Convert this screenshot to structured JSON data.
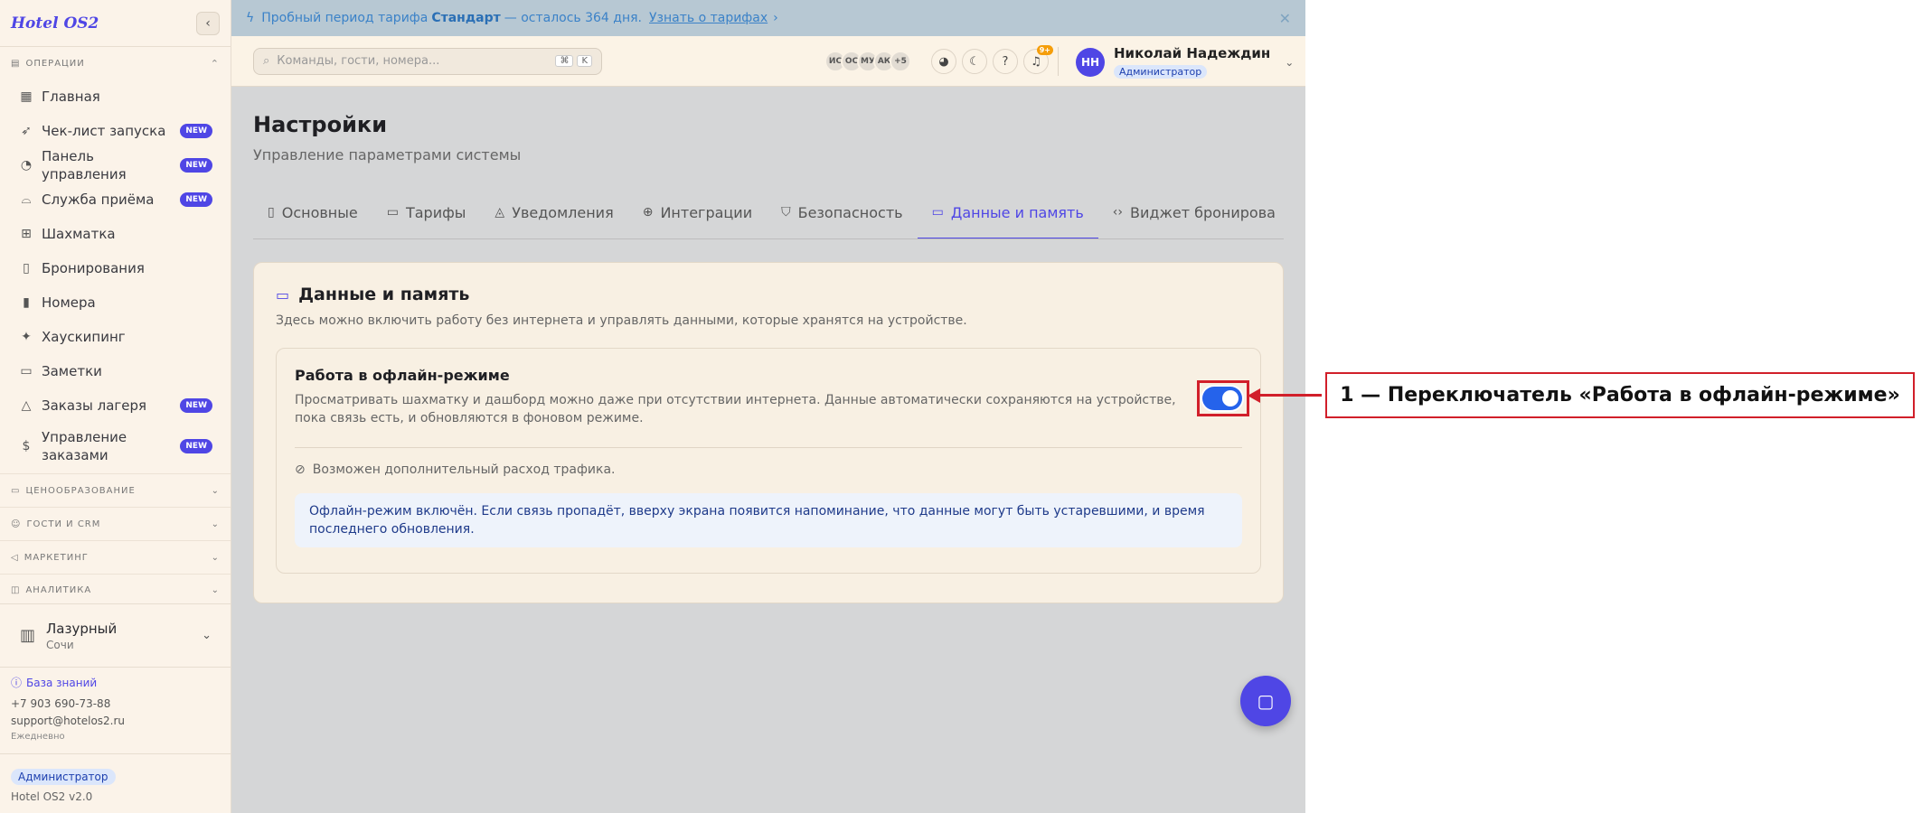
{
  "sidebar": {
    "logo": "Hotel OS2",
    "sections": {
      "operations": "ОПЕРАЦИИ"
    },
    "items": [
      {
        "label": "Главная",
        "icon": "dashboard-icon",
        "badge": ""
      },
      {
        "label": "Чек-лист запуска",
        "icon": "rocket-icon",
        "badge": "NEW"
      },
      {
        "label": "Панель управления",
        "icon": "gauge-icon",
        "badge": "NEW"
      },
      {
        "label": "Служба приёма",
        "icon": "bell-desk-icon",
        "badge": "NEW"
      },
      {
        "label": "Шахматка",
        "icon": "grid-icon",
        "badge": ""
      },
      {
        "label": "Бронирования",
        "icon": "clipboard-icon",
        "badge": ""
      },
      {
        "label": "Номера",
        "icon": "door-icon",
        "badge": ""
      },
      {
        "label": "Хаускипинг",
        "icon": "sparkle-icon",
        "badge": ""
      },
      {
        "label": "Заметки",
        "icon": "note-icon",
        "badge": ""
      },
      {
        "label": "Заказы лагеря",
        "icon": "tent-icon",
        "badge": "NEW"
      },
      {
        "label": "Управление заказами",
        "icon": "receipt-icon",
        "badge": "NEW"
      }
    ],
    "collapsed_sections": [
      "ЦЕНООБРАЗОВАНИЕ",
      "ГОСТИ И CRM",
      "МАРКЕТИНГ",
      "АНАЛИТИКА"
    ],
    "hotel": {
      "name": "Лазурный",
      "city": "Сочи"
    },
    "support": {
      "knowledge_base": "База знаний",
      "phone": "+7 903 690-73-88",
      "email": "support@hotelos2.ru",
      "schedule": "Ежедневно"
    },
    "role": "Администратор",
    "version": "Hotel OS2 v2.0"
  },
  "banner": {
    "prefix": "Пробный период тарифа",
    "plan": "Стандарт",
    "suffix": "— осталось 364 дня.",
    "link": "Узнать о тарифах"
  },
  "topbar": {
    "search_placeholder": "Команды, гости, номера...",
    "kbd1": "⌘",
    "kbd2": "K",
    "avatars": [
      "ИС",
      "ОС",
      "МУ",
      "АК",
      "+5"
    ],
    "notifications_count": "9+",
    "user": {
      "initials": "НН",
      "name": "Николай Надеждин",
      "role": "Администратор"
    }
  },
  "page": {
    "title": "Настройки",
    "subtitle": "Управление параметрами системы",
    "tabs": [
      {
        "label": "Основные",
        "icon": "building-icon"
      },
      {
        "label": "Тарифы",
        "icon": "card-icon"
      },
      {
        "label": "Уведомления",
        "icon": "bell-icon"
      },
      {
        "label": "Интеграции",
        "icon": "globe-icon"
      },
      {
        "label": "Безопасность",
        "icon": "shield-icon"
      },
      {
        "label": "Данные и память",
        "icon": "drive-icon"
      },
      {
        "label": "Виджет бронирова",
        "icon": "code-icon"
      }
    ]
  },
  "card": {
    "title": "Данные и память",
    "description": "Здесь можно включить работу без интернета и управлять данными, которые хранятся на устройстве.",
    "offline": {
      "title": "Работа в офлайн-режиме",
      "description": "Просматривать шахматку и дашборд можно даже при отсутствии интернета. Данные автоматически сохраняются на устройстве, пока связь есть, и обновляются в фоновом режиме.",
      "enabled": true
    },
    "traffic_note": "Возможен дополнительный расход трафика.",
    "info": "Офлайн-режим включён. Если связь пропадёт, вверху экрана появится напоминание, что данные могут быть устаревшими, и время последнего обновления."
  },
  "annotation": {
    "label": "1 — Переключатель «Работа в офлайн-режиме»"
  },
  "colors": {
    "accent": "#4f46e5",
    "toggle_on": "#2563eb",
    "annotation": "#d11f2a"
  }
}
